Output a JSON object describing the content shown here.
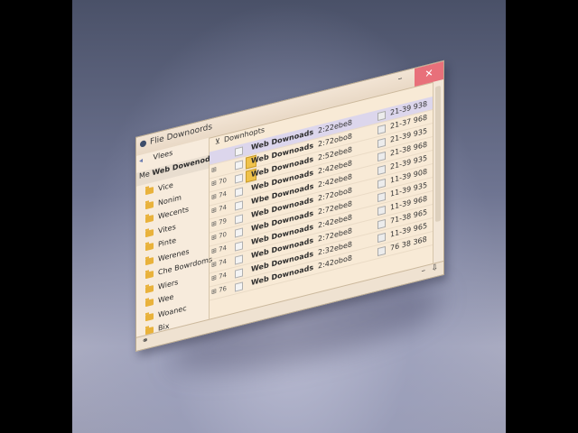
{
  "window": {
    "title": "Flie Downoords",
    "minimize_glyph": "–",
    "close_glyph": "✕",
    "address": {
      "icon_glyph": "◂",
      "left": "Vlees",
      "right_icon_glyph": "⊻",
      "right": "Downhopts"
    },
    "sidebar": {
      "header_prefix": "Me",
      "header": "Web Dowenods",
      "items": [
        {
          "label": "Vice"
        },
        {
          "label": "Nonim"
        },
        {
          "label": "Wecents"
        },
        {
          "label": "Vites"
        },
        {
          "label": "Pinte"
        },
        {
          "label": "Werenes"
        },
        {
          "label": "Che Bowrdoms"
        },
        {
          "label": "Wiers"
        },
        {
          "label": "Wee"
        },
        {
          "label": "Woanec"
        },
        {
          "label": "Bix"
        }
      ]
    },
    "files": [
      {
        "name": "Web Downoads",
        "date": "2:22ebe8",
        "time": "21-39 938",
        "selected": true
      },
      {
        "name": "Web Downoads",
        "date": "2:72obo8",
        "time": "21-37 968",
        "prefix": "⊞",
        "folder": true
      },
      {
        "name": "Web Downoads",
        "date": "2:52ebe8",
        "time": "21-39 935",
        "prefix": "⊞ 70",
        "folder": true
      },
      {
        "name": "Web Downoads",
        "date": "2:42ebe8",
        "time": "21-38 968",
        "prefix": "⊞ 74"
      },
      {
        "name": "Wbe Downoads",
        "date": "2:42ebe8",
        "time": "21-39 935",
        "prefix": "⊞ 74"
      },
      {
        "name": "Web Downoads",
        "date": "2:72obo8",
        "time": "11-39 908",
        "prefix": "⊞ 79"
      },
      {
        "name": "Web Downoads",
        "date": "2:72ebe8",
        "time": "11-39 935",
        "prefix": "⊞ 70"
      },
      {
        "name": "Web Downoads",
        "date": "2:42ebe8",
        "time": "11-39 968",
        "prefix": "⊞ 74"
      },
      {
        "name": "Web Downoads",
        "date": "2:72ebe8",
        "time": "71-38 965",
        "prefix": "⊞ 74"
      },
      {
        "name": "Web Downoads",
        "date": "2:32ebe8",
        "time": "11-39 965",
        "prefix": "⊞ 74"
      },
      {
        "name": "Web Downoads",
        "date": "2:42obo8",
        "time": "76 38 368",
        "prefix": "⊞ 76"
      }
    ],
    "statusbar": {
      "left_glyph": "⚭",
      "right_glyphs": [
        "–",
        "⇩"
      ]
    }
  },
  "colors": {
    "window_bg": "#f8ead6",
    "close_button": "#e8707a",
    "folder": "#e9b23b",
    "selected_row": "#dcd6ec"
  }
}
